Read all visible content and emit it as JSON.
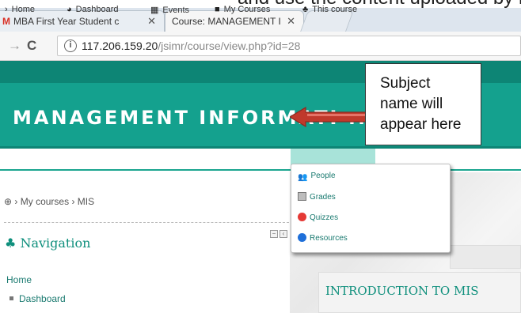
{
  "caption_clip": "and use the content uploaded by respective teacher",
  "browser": {
    "tabs": [
      {
        "label": "MBA First Year Student c",
        "icon": "gmail-icon"
      },
      {
        "label": "Course: MANAGEMENT I",
        "icon": ""
      }
    ],
    "tab_close": "✕",
    "address": {
      "host": "117.206.159.20",
      "path": "/jsimr/course/view.php?id=28"
    }
  },
  "header": {
    "course_title": "MANAGEMENT INFORMATI ..."
  },
  "annotation": {
    "line1": "Subject",
    "line2": "name will",
    "line3": "appear here"
  },
  "menu": {
    "items": [
      {
        "label": "Home",
        "icon": "arrow-icon"
      },
      {
        "label": "Dashboard",
        "icon": "dashboard-icon"
      },
      {
        "label": "Events",
        "icon": "calendar-icon"
      },
      {
        "label": "My Courses",
        "icon": "briefcase-icon"
      },
      {
        "label": "This course",
        "icon": "sitemap-icon"
      }
    ]
  },
  "dropdown": {
    "items": [
      {
        "label": "People",
        "icon": "users-icon"
      },
      {
        "label": "Grades",
        "icon": "grades-icon"
      },
      {
        "label": "Quizzes",
        "icon": "quiz-icon"
      },
      {
        "label": "Resources",
        "icon": "resources-icon"
      }
    ]
  },
  "breadcrumb": {
    "first": "⊕",
    "sep1": "›",
    "my_courses": "My courses",
    "sep2": "›",
    "current": "MIS"
  },
  "navigation_block": {
    "title": "Navigation",
    "home": "Home",
    "dashboard": "Dashboard"
  },
  "main": {
    "section_title": "INTRODUCTION TO MIS"
  },
  "colors": {
    "brand_teal": "#14a18e",
    "dark_teal": "#0d8575",
    "link": "#1a7a70",
    "active_menu": "#a8e3d9",
    "arrow": "#c0392b"
  }
}
